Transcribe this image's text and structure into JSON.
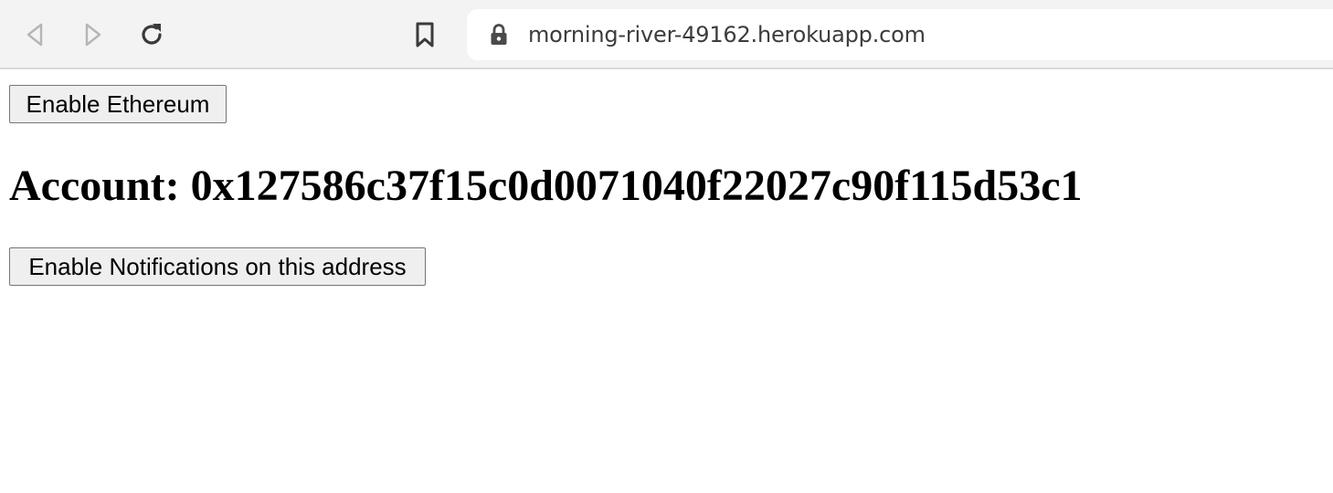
{
  "browser": {
    "url": "morning-river-49162.herokuapp.com",
    "icons": {
      "back": "back-arrow-icon",
      "forward": "forward-arrow-icon",
      "reload": "reload-icon",
      "bookmark": "bookmark-icon",
      "lock": "lock-icon"
    }
  },
  "page": {
    "enable_ethereum_label": "Enable Ethereum",
    "account_heading": "Account: 0x127586c37f15c0d0071040f22027c90f115d53c1",
    "enable_notifications_label": "Enable Notifications on this address"
  }
}
